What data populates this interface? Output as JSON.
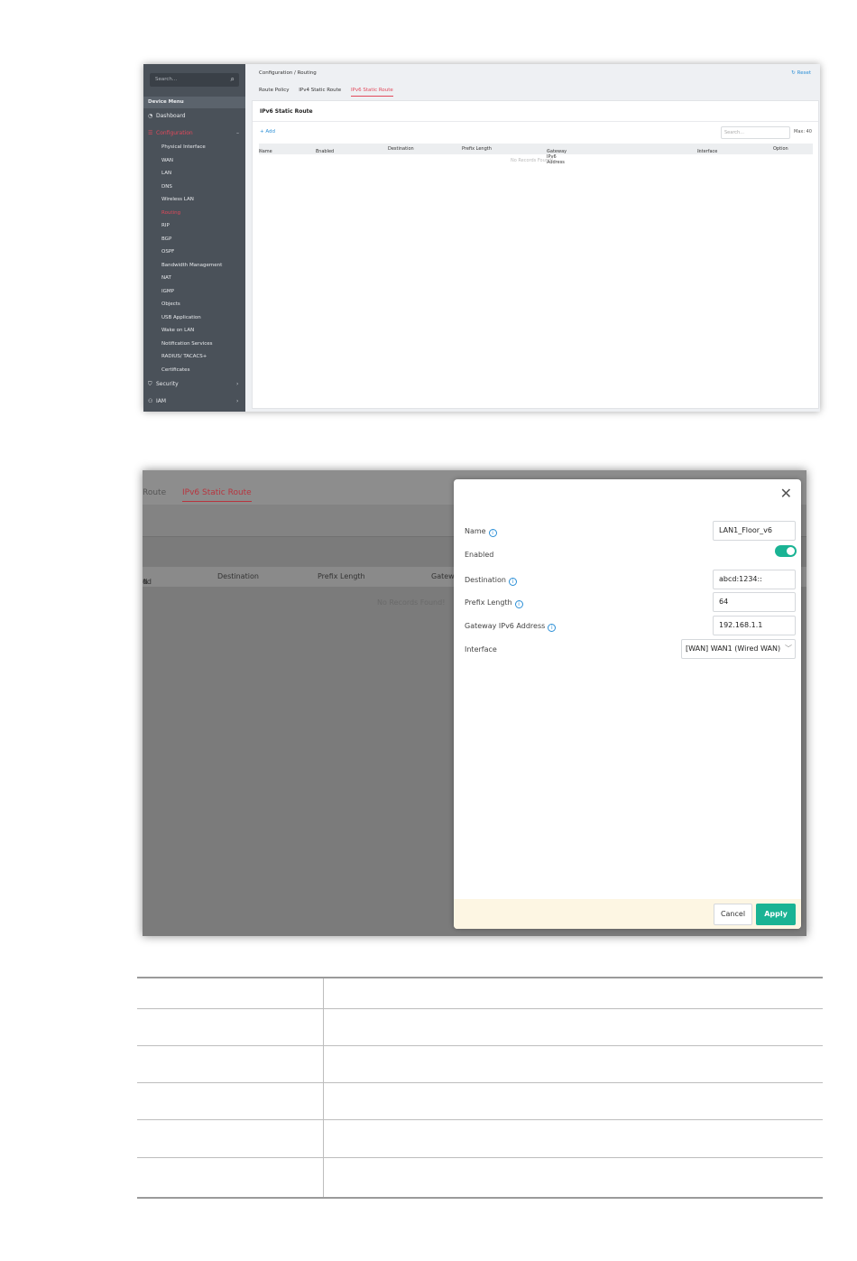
{
  "screen1": {
    "sidebar": {
      "search_placeholder": "Search...",
      "search_icon": "search-icon",
      "menu_heading": "Device Menu",
      "dashboard": "Dashboard",
      "configuration": "Configuration",
      "config_items": [
        "Physical Interface",
        "WAN",
        "LAN",
        "DNS",
        "Wireless LAN",
        "Routing",
        "RIP",
        "BGP",
        "OSPF",
        "Bandwidth Management",
        "NAT",
        "IGMP",
        "Objects",
        "USB Application",
        "Wake on LAN",
        "Notification Services",
        "RADIUS/ TACACS+",
        "Certificates"
      ],
      "active_item": "Routing",
      "security": "Security",
      "iam": "IAM",
      "collapse_glyph": "–",
      "expand_glyph": "›"
    },
    "breadcrumb": "Configuration / Routing",
    "reset_label": "Reset",
    "tabs": [
      "Route Policy",
      "IPv4 Static Route",
      "IPv6 Static Route"
    ],
    "active_tab": "IPv6 Static Route",
    "card_title": "IPv6 Static Route",
    "add_label": "+ Add",
    "search_placeholder": "Search...",
    "max_label": "Max: 40",
    "columns": [
      "Name",
      "Enabled",
      "Destination",
      "Prefix Length",
      "Gateway IPv6 Address",
      "Interface",
      "Option"
    ],
    "sort_glyph": "⇅",
    "no_records": "No Records Found!"
  },
  "screen2": {
    "bg_tab_partial": "Route",
    "bg_tab_active": "IPv6 Static Route",
    "bg_columns": [
      "ed",
      "Destination",
      "Prefix Length",
      "Gatew"
    ],
    "bg_sort_glyph": "⇅",
    "bg_no_records": "No Records Found!",
    "panel": {
      "close_icon": "close-icon",
      "close_glyph": "✕",
      "info_glyph": "i",
      "fields": {
        "name_label": "Name",
        "name_value": "LAN1_Floor_v6",
        "enabled_label": "Enabled",
        "enabled": true,
        "destination_label": "Destination",
        "destination_value": "abcd:1234::",
        "prefix_label": "Prefix Length",
        "prefix_value": "64",
        "gateway_label": "Gateway IPv6 Address",
        "gateway_value": "192.168.1.1",
        "interface_label": "Interface",
        "interface_value": "[WAN] WAN1 (Wired WAN)"
      },
      "chevron_glyph": "﹀",
      "cancel_label": "Cancel",
      "apply_label": "Apply"
    }
  },
  "colors": {
    "accent_red": "#e2485a",
    "link_blue": "#2b8fd6",
    "toggle_green": "#1ab394",
    "sidebar_bg": "#4a5159"
  }
}
